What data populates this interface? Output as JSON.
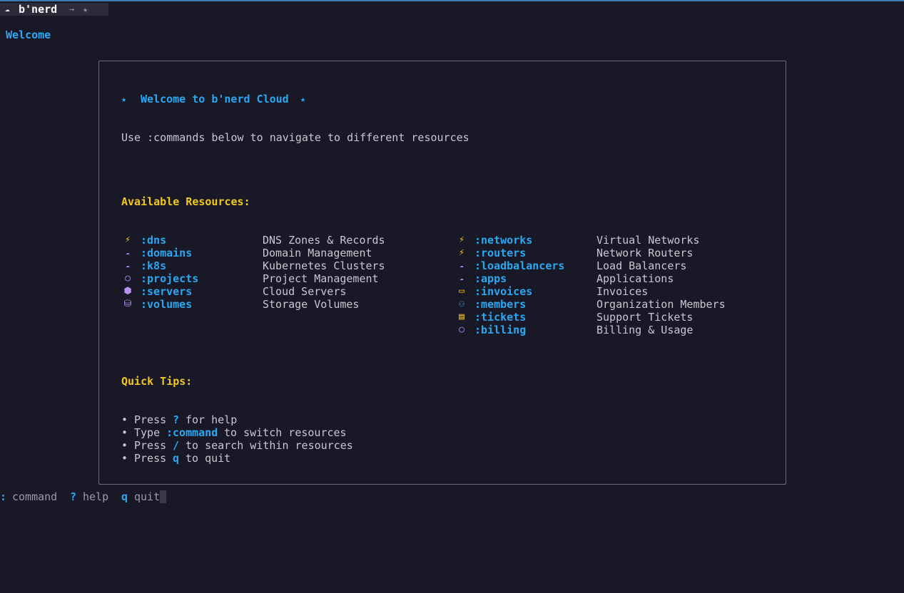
{
  "titlebar": {
    "icon": "cloud-icon",
    "name": "b'nerd",
    "arrow": "→",
    "star": "★"
  },
  "tab": {
    "label": "Welcome"
  },
  "panel": {
    "heading_star": "★",
    "heading": "Welcome to b'nerd Cloud",
    "intro": "Use :commands below to navigate to different resources",
    "resources_title": "Available Resources:",
    "left_resources": [
      {
        "icon": "lightning-icon",
        "glyph": "⚡",
        "cmd": ":dns",
        "desc": "DNS Zones & Records"
      },
      {
        "icon": "cloud-icon",
        "glyph": "☁",
        "cmd": ":domains",
        "desc": "Domain Management"
      },
      {
        "icon": "cloud-icon",
        "glyph": "☁",
        "cmd": ":k8s",
        "desc": "Kubernetes Clusters"
      },
      {
        "icon": "circle-icon",
        "glyph": "○",
        "cmd": ":projects",
        "desc": "Project Management"
      },
      {
        "icon": "hexagon-icon",
        "glyph": "⬢",
        "cmd": ":servers",
        "desc": "Cloud Servers"
      },
      {
        "icon": "disk-icon",
        "glyph": "⛁",
        "cmd": ":volumes",
        "desc": "Storage Volumes"
      }
    ],
    "right_resources": [
      {
        "icon": "lightning-icon",
        "glyph": "⚡",
        "cmd": ":networks",
        "desc": "Virtual Networks"
      },
      {
        "icon": "lightning-icon",
        "glyph": "⚡",
        "cmd": ":routers",
        "desc": "Network Routers"
      },
      {
        "icon": "cloud-icon",
        "glyph": "☁",
        "cmd": ":loadbalancers",
        "desc": "Load Balancers"
      },
      {
        "icon": "cloud-icon",
        "glyph": "☁",
        "cmd": ":apps",
        "desc": "Applications"
      },
      {
        "icon": "credit-card-icon",
        "glyph": "▭",
        "cmd": ":invoices",
        "desc": "Invoices"
      },
      {
        "icon": "people-icon",
        "glyph": "⚇",
        "cmd": ":members",
        "desc": "Organization Members"
      },
      {
        "icon": "ticket-icon",
        "glyph": "▤",
        "cmd": ":tickets",
        "desc": "Support Tickets"
      },
      {
        "icon": "circle-icon",
        "glyph": "○",
        "cmd": ":billing",
        "desc": "Billing & Usage"
      }
    ],
    "tips_title": "Quick Tips:",
    "tips": [
      {
        "bullet": "•",
        "pre": "Press",
        "key": "?",
        "post": "for help"
      },
      {
        "bullet": "•",
        "pre": "Type",
        "key": ":command",
        "post": "to switch resources"
      },
      {
        "bullet": "•",
        "pre": "Press",
        "key": "/",
        "post": "to search within resources"
      },
      {
        "bullet": "•",
        "pre": "Press",
        "key": "q",
        "post": "to quit"
      }
    ]
  },
  "statusbar": {
    "cmd_key": ":",
    "cmd_label": "command",
    "help_key": "?",
    "help_label": "help",
    "quit_key": "q",
    "quit_label": "quit"
  },
  "colors": {
    "background": "#181826",
    "accent": "#2aa8f2",
    "section_title": "#f2c81e",
    "text": "#c8c8d2",
    "icon_purple": "#b490f0"
  }
}
